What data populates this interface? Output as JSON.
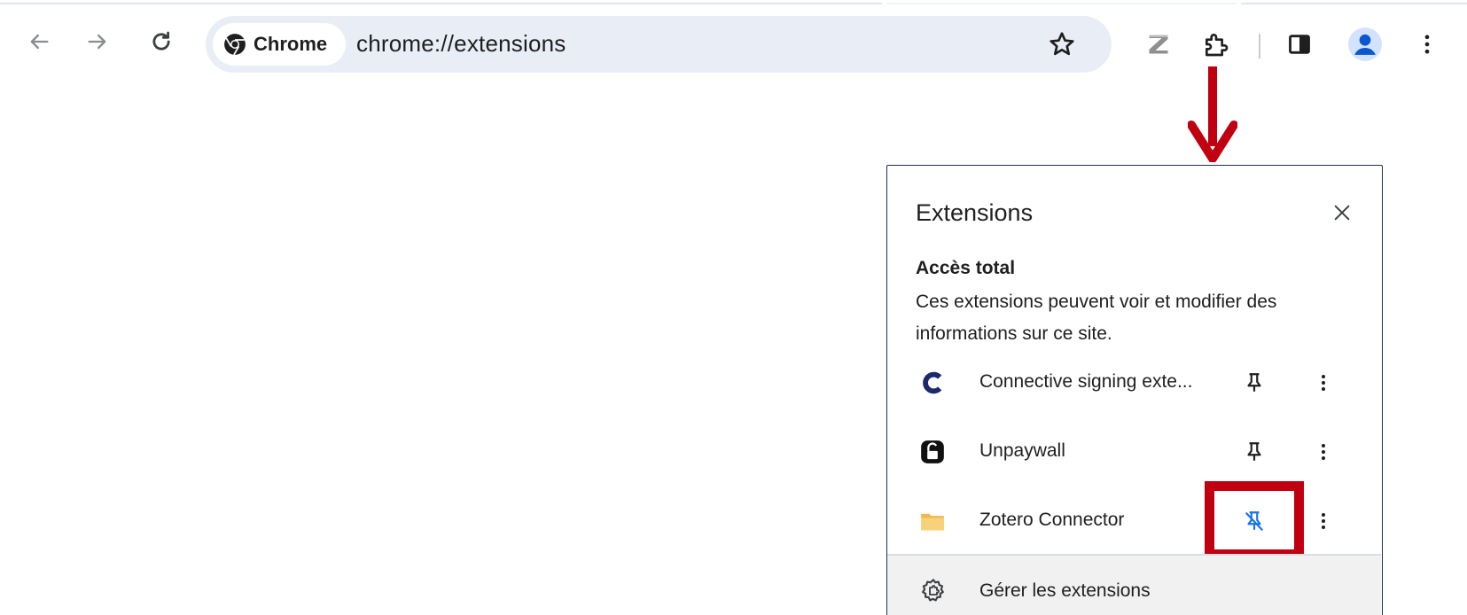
{
  "browser": {
    "chip_label": "Chrome",
    "url": "chrome://extensions",
    "nav": {
      "back_icon": "arrow-left-icon",
      "forward_icon": "arrow-right-icon",
      "reload_icon": "reload-icon"
    },
    "toolbar_icons": [
      "zotero-icon",
      "puzzle-extensions-icon",
      "side-panel-icon",
      "profile-avatar-icon",
      "kebab-menu-icon"
    ]
  },
  "extensions_popup": {
    "title": "Extensions",
    "section_heading": "Accès total",
    "section_description": "Ces extensions peuvent voir et modifier des informations sur ce site.",
    "items": [
      {
        "name": "Connective signing exte...",
        "icon": "connective-c-icon",
        "pinned": false
      },
      {
        "name": "Unpaywall",
        "icon": "unpaywall-lock-icon",
        "pinned": false
      },
      {
        "name": "Zotero Connector",
        "icon": "folder-icon",
        "pinned": true
      }
    ],
    "manage_label": "Gérer les extensions"
  },
  "colors": {
    "annotation_red": "#c00010",
    "pinned_blue": "#1a73e8",
    "omnibox_bg": "#e9edf5"
  }
}
